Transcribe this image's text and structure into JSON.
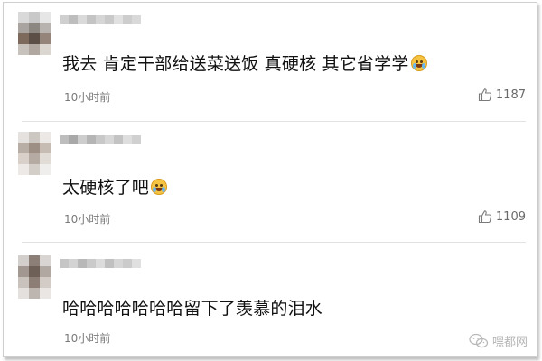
{
  "comments": [
    {
      "text": "我去 肯定干部给送菜送饭 真硬核 其它省学学",
      "emoji": "crying-laughing-emoji",
      "time": "10小时前",
      "likes": "1187"
    },
    {
      "text": "太硬核了吧",
      "emoji": "laughing-emoji",
      "time": "10小时前",
      "likes": "1109"
    },
    {
      "text": "哈哈哈哈哈哈哈留下了羡慕的泪水",
      "time": "10小时前",
      "likes": ""
    }
  ],
  "watermark": {
    "text": "嘿都网"
  },
  "colors": {
    "text": "#111111",
    "meta": "#7a7a7a",
    "divider": "#e2e2e2",
    "border": "#cfcfcf"
  }
}
